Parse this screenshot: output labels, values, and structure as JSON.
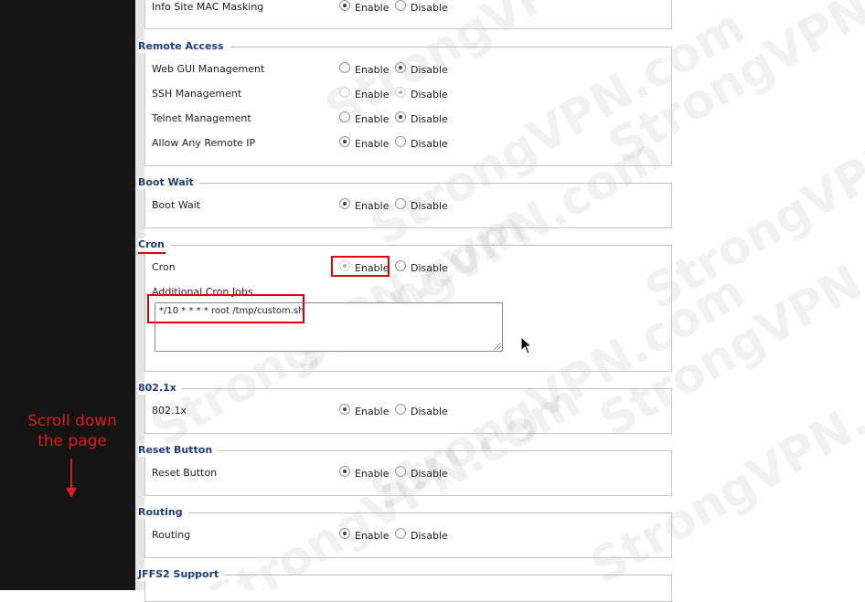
{
  "annotation": {
    "line1": "Scroll down",
    "line2": "the page"
  },
  "watermark": "StrongVPN.com",
  "sections": {
    "info_site": {
      "label": "Info Site MAC Masking",
      "enable": "Enable",
      "disable": "Disable"
    },
    "remote_access": {
      "title": "Remote Access",
      "rows": [
        {
          "label": "Web GUI Management",
          "enable": "Enable",
          "disable": "Disable"
        },
        {
          "label": "SSH Management",
          "enable": "Enable",
          "disable": "Disable"
        },
        {
          "label": "Telnet Management",
          "enable": "Enable",
          "disable": "Disable"
        },
        {
          "label": "Allow Any Remote IP",
          "enable": "Enable",
          "disable": "Disable"
        }
      ]
    },
    "boot_wait": {
      "title": "Boot Wait",
      "label": "Boot Wait",
      "enable": "Enable",
      "disable": "Disable"
    },
    "cron": {
      "title": "Cron",
      "label": "Cron",
      "enable": "Enable",
      "disable": "Disable",
      "jobs_label": "Additional Cron Jobs",
      "jobs_value": "*/10 * * * * root /tmp/custom.sh"
    },
    "dot1x": {
      "title": "802.1x",
      "label": "802.1x",
      "enable": "Enable",
      "disable": "Disable"
    },
    "reset_button": {
      "title": "Reset Button",
      "label": "Reset Button",
      "enable": "Enable",
      "disable": "Disable"
    },
    "routing": {
      "title": "Routing",
      "label": "Routing",
      "enable": "Enable",
      "disable": "Disable"
    },
    "jffs2": {
      "title": "JFFS2 Support"
    }
  },
  "colors": {
    "annotation": "#e11a1a",
    "section_title": "#1f3d7a",
    "highlight": "#e00000"
  }
}
